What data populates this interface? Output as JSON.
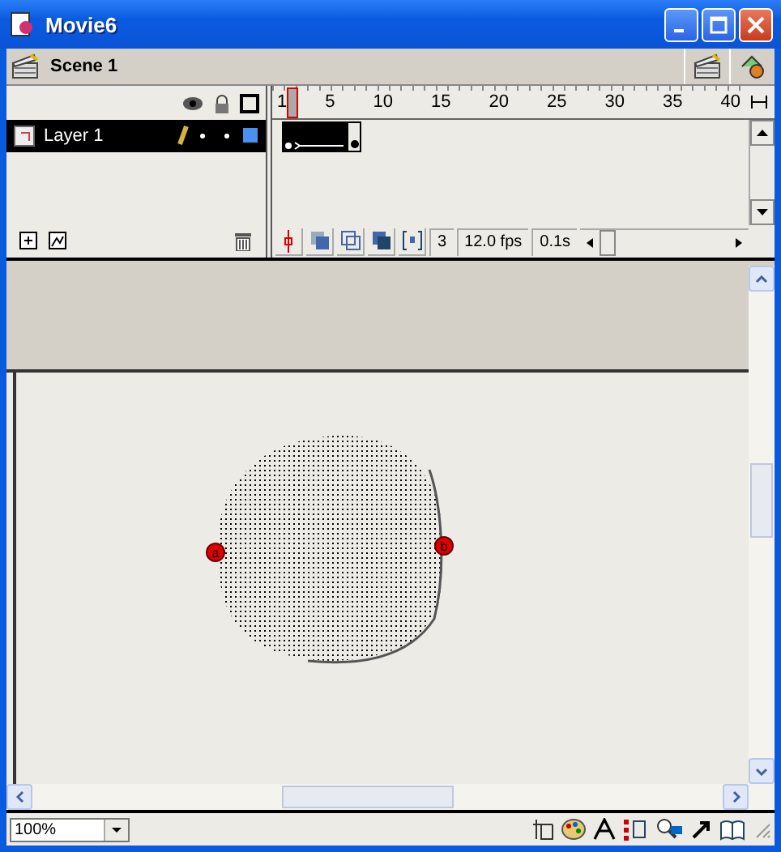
{
  "window": {
    "title": "Movie6"
  },
  "scene": {
    "name": "Scene 1"
  },
  "timeline": {
    "ruler": [
      "1",
      "5",
      "10",
      "15",
      "20",
      "25",
      "30",
      "35",
      "40"
    ],
    "layers": [
      {
        "name": "Layer 1",
        "selected": true
      }
    ],
    "current_frame": "3",
    "frame_rate": "12.0 fps",
    "elapsed_time": "0.1s"
  },
  "stage": {
    "shape_hints": [
      {
        "label": "a"
      },
      {
        "label": "b"
      }
    ]
  },
  "status_bar": {
    "zoom": "100%"
  }
}
